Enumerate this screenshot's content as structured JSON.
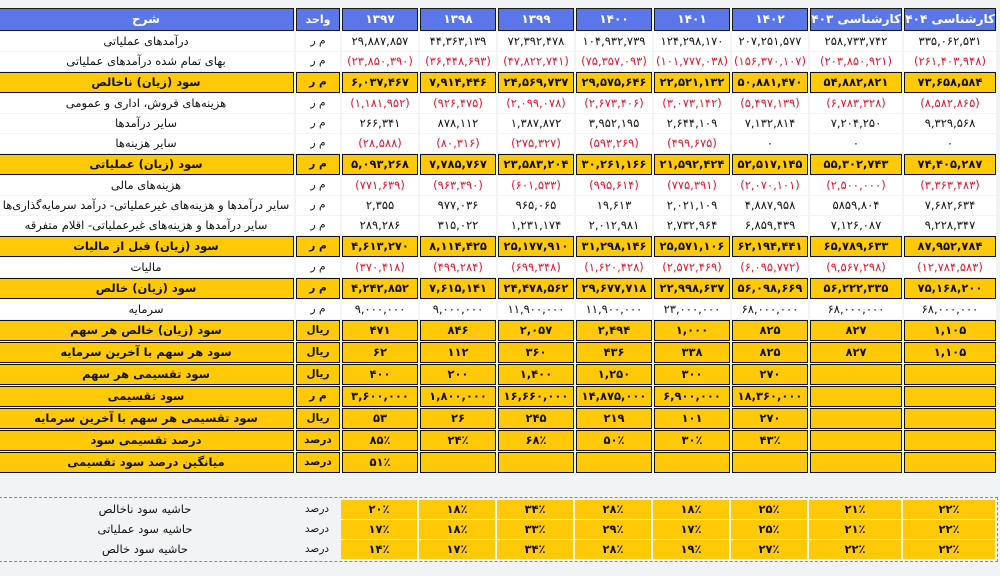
{
  "colors": {
    "header_bg": "#5a76e8",
    "header_fg": "#ffffff",
    "highlight_bg": "#ffc907",
    "negative_fg": "#e8132b",
    "page_bg": "#f2f3f5"
  },
  "header": {
    "description": "شرح",
    "unit": "واحد",
    "years": [
      "۱۳۹۷",
      "۱۳۹۸",
      "۱۳۹۹",
      "۱۴۰۰",
      "۱۴۰۱",
      "۱۴۰۲",
      "کارشناسی ۱۴۰۳",
      "کارشناسی ۱۴۰۴"
    ]
  },
  "rows": [
    {
      "label": "درآمدهای عملیاتی",
      "unit": "م ر",
      "style": "plain",
      "values": [
        "۲۹,۸۸۷,۸۵۷",
        "۴۴,۳۶۳,۱۳۹",
        "۷۲,۳۹۲,۴۷۸",
        "۱۰۴,۹۳۲,۷۳۹",
        "۱۲۴,۲۹۸,۱۷۰",
        "۲۰۷,۲۵۱,۵۷۷",
        "۲۵۸,۷۳۳,۷۴۲",
        "۳۳۵,۰۶۲,۵۳۱"
      ],
      "negative": [
        false,
        false,
        false,
        false,
        false,
        false,
        false,
        false
      ]
    },
    {
      "label": "بهای تمام شده درآمدهای عملیاتی",
      "unit": "م ر",
      "style": "plain",
      "values": [
        "(۲۳,۸۵۰,۳۹۰)",
        "(۳۶,۴۴۸,۶۹۳)",
        "(۴۷,۸۲۲,۷۴۱)",
        "(۷۵,۳۵۷,۰۹۳)",
        "(۱۰۱,۷۷۷,۰۳۸)",
        "(۱۵۶,۳۷۰,۱۰۷)",
        "(۲۰۳,۸۵۰,۹۲۱)",
        "(۲۶۱,۴۰۳,۹۴۸)"
      ],
      "negative": [
        true,
        true,
        true,
        true,
        true,
        true,
        true,
        true
      ]
    },
    {
      "label": "سود (زیان) ناخالص",
      "unit": "م ر",
      "style": "highlight",
      "values": [
        "۶,۰۳۷,۴۶۷",
        "۷,۹۱۴,۴۴۶",
        "۲۴,۵۶۹,۷۳۷",
        "۲۹,۵۷۵,۶۴۶",
        "۲۲,۵۲۱,۱۳۲",
        "۵۰,۸۸۱,۴۷۰",
        "۵۴,۸۸۲,۸۲۱",
        "۷۳,۶۵۸,۵۸۴"
      ],
      "negative": [
        false,
        false,
        false,
        false,
        false,
        false,
        false,
        false
      ]
    },
    {
      "label": "هزینه‌های فروش، اداری و عمومی",
      "unit": "م ر",
      "style": "plain",
      "values": [
        "(۱,۱۸۱,۹۵۲)",
        "(۹۲۶,۴۷۵)",
        "(۲,۰۹۹,۰۷۸)",
        "(۲,۶۷۳,۴۰۶)",
        "(۳,۰۷۳,۱۴۲)",
        "(۵,۴۹۷,۱۳۹)",
        "(۶,۷۸۳,۳۲۸)",
        "(۸,۵۸۲,۸۶۵)"
      ],
      "negative": [
        true,
        true,
        true,
        true,
        true,
        true,
        true,
        true
      ]
    },
    {
      "label": "سایر درآمدها",
      "unit": "م ر",
      "style": "plain",
      "values": [
        "۲۶۶,۳۴۱",
        "۸۷۸,۱۱۲",
        "۱,۳۸۷,۸۷۲",
        "۳,۹۵۲,۱۹۵",
        "۲,۶۴۴,۱۰۹",
        "۷,۱۳۲,۸۱۴",
        "۷,۲۰۴,۲۵۰",
        "۹,۳۲۹,۵۶۸"
      ],
      "negative": [
        false,
        false,
        false,
        false,
        false,
        false,
        false,
        false
      ]
    },
    {
      "label": "سایر هزینه‌ها",
      "unit": "م ر",
      "style": "plain",
      "values": [
        "(۲۸,۵۸۸)",
        "(۸۰,۳۱۶)",
        "(۲۷۵,۳۲۷)",
        "(۵۹۳,۲۶۹)",
        "(۴۹۹,۶۷۵)",
        "۰",
        "۰",
        "۰"
      ],
      "negative": [
        true,
        true,
        true,
        true,
        true,
        false,
        false,
        false
      ]
    },
    {
      "label": "سود (زیان) عملیاتی",
      "unit": "م ر",
      "style": "highlight",
      "values": [
        "۵,۰۹۳,۲۶۸",
        "۷,۷۸۵,۷۶۷",
        "۲۳,۵۸۳,۲۰۴",
        "۳۰,۲۶۱,۱۶۶",
        "۲۱,۵۹۲,۴۲۴",
        "۵۲,۵۱۷,۱۴۵",
        "۵۵,۳۰۲,۷۴۳",
        "۷۴,۴۰۵,۲۸۷"
      ],
      "negative": [
        false,
        false,
        false,
        false,
        false,
        false,
        false,
        false
      ]
    },
    {
      "label": "هزینه‌های مالی",
      "unit": "م ر",
      "style": "plain",
      "values": [
        "(۷۷۱,۶۳۹)",
        "(۹۶۳,۳۹۰)",
        "(۶۰۱,۵۳۳)",
        "(۹۹۵,۶۱۴)",
        "(۷۷۵,۳۹۱)",
        "(۲,۰۷۰,۱۰۱)",
        "(۲,۵۰۰,۰۰۰)",
        "(۳,۳۶۳,۴۸۳)"
      ],
      "negative": [
        true,
        true,
        true,
        true,
        true,
        true,
        true,
        true
      ]
    },
    {
      "label": "سایر درآمدها و هزینه‌های غیرعملیاتی- درآمد سرمایه‌گذاری‌ها",
      "unit": "م ر",
      "style": "plain",
      "values": [
        "۲,۳۵۵",
        "۹۷۷,۰۳۶",
        "۹۶۵,۰۶۵",
        "۱۹,۶۱۳",
        "۲,۰۲۱,۱۰۹",
        "۴,۸۸۷,۹۵۸",
        "۵۸۵۹,۸۰۴",
        "۷,۶۸۲,۶۳۴"
      ],
      "negative": [
        false,
        false,
        false,
        false,
        false,
        false,
        false,
        false
      ]
    },
    {
      "label": "سایر درآمدها و هزینه‌های غیرعملیاتی- اقلام متفرقه",
      "unit": "م ر",
      "style": "plain",
      "values": [
        "۲۸۹,۲۸۶",
        "۳۱۵,۰۲۲",
        "۱,۲۳۱,۱۷۴",
        "۲,۰۱۲,۹۸۱",
        "۲,۷۳۲,۹۶۴",
        "۶,۸۵۹,۴۳۹",
        "۷,۱۲۶,۰۸۷",
        "۹,۲۲۸,۳۴۷"
      ],
      "negative": [
        false,
        false,
        false,
        false,
        false,
        false,
        false,
        false
      ]
    },
    {
      "label": "سود (زیان) قبل از مالیات",
      "unit": "م ر",
      "style": "highlight",
      "values": [
        "۴,۶۱۳,۲۷۰",
        "۸,۱۱۴,۴۲۵",
        "۲۵,۱۷۷,۹۱۰",
        "۳۱,۲۹۸,۱۴۶",
        "۲۵,۵۷۱,۱۰۶",
        "۶۲,۱۹۴,۴۴۱",
        "۶۵,۷۸۹,۶۳۳",
        "۸۷,۹۵۲,۷۸۴"
      ],
      "negative": [
        false,
        false,
        false,
        false,
        false,
        false,
        false,
        false
      ]
    },
    {
      "label": "مالیات",
      "unit": "م ر",
      "style": "plain",
      "values": [
        "(۳۷۰,۴۱۸)",
        "(۴۹۹,۲۸۴)",
        "(۶۹۹,۳۴۸)",
        "(۱,۶۲۰,۴۲۸)",
        "(۲,۵۷۲,۴۶۹)",
        "(۶,۰۹۵,۷۷۲)",
        "(۹,۵۶۷,۲۹۸)",
        "(۱۲,۷۸۴,۵۸۳)"
      ],
      "negative": [
        true,
        true,
        true,
        true,
        true,
        true,
        true,
        true
      ]
    },
    {
      "label": "سود (زیان) خالص",
      "unit": "م ر",
      "style": "highlight",
      "values": [
        "۴,۲۴۲,۸۵۲",
        "۷,۶۱۵,۱۴۱",
        "۲۴,۴۷۸,۵۶۲",
        "۲۹,۶۷۷,۷۱۸",
        "۲۲,۹۹۸,۶۳۷",
        "۵۶,۰۹۸,۶۶۹",
        "۵۶,۲۲۲,۳۳۵",
        "۷۵,۱۶۸,۲۰۰"
      ],
      "negative": [
        false,
        false,
        false,
        false,
        false,
        false,
        false,
        false
      ]
    },
    {
      "label": "سرمایه",
      "unit": "م ر",
      "style": "plain",
      "values": [
        "۹,۰۰۰,۰۰۰",
        "۹,۰۰۰,۰۰۰",
        "۱۱,۹۰۰,۰۰۰",
        "۱۱,۹۰۰,۰۰۰",
        "۲۳,۰۰۰,۰۰۰",
        "۶۸,۰۰۰,۰۰۰",
        "۶۸,۰۰۰,۰۰۰",
        "۶۸,۰۰۰,۰۰۰"
      ],
      "negative": [
        false,
        false,
        false,
        false,
        false,
        false,
        false,
        false
      ]
    },
    {
      "label": "سود (زیان) خالص هر سهم",
      "unit": "ریال",
      "style": "highlight",
      "values": [
        "۴۷۱",
        "۸۴۶",
        "۲,۰۵۷",
        "۲,۴۹۴",
        "۱,۰۰۰",
        "۸۲۵",
        "۸۲۷",
        "۱,۱۰۵"
      ],
      "negative": [
        false,
        false,
        false,
        false,
        false,
        false,
        false,
        false
      ]
    },
    {
      "label": "سود هر سهم با آخرین سرمایه",
      "unit": "ریال",
      "style": "highlight",
      "values": [
        "۶۲",
        "۱۱۲",
        "۳۶۰",
        "۴۳۶",
        "۳۳۸",
        "۸۲۵",
        "۸۲۷",
        "۱,۱۰۵"
      ],
      "negative": [
        false,
        false,
        false,
        false,
        false,
        false,
        false,
        false
      ]
    },
    {
      "label": "سود تقسیمی هر سهم",
      "unit": "ریال",
      "style": "highlight",
      "values": [
        "۴۰۰",
        "۲۰۰",
        "۱,۴۰۰",
        "۱,۲۵۰",
        "۳۰۰",
        "۲۷۰",
        "",
        ""
      ],
      "negative": [
        false,
        false,
        false,
        false,
        false,
        false,
        false,
        false
      ]
    },
    {
      "label": "سود تقسیمی",
      "unit": "م ر",
      "style": "highlight",
      "values": [
        "۳,۶۰۰,۰۰۰",
        "۱,۸۰۰,۰۰۰",
        "۱۶,۶۶۰,۰۰۰",
        "۱۴,۸۷۵,۰۰۰",
        "۶,۹۰۰,۰۰۰",
        "۱۸,۳۶۰,۰۰۰",
        "",
        ""
      ],
      "negative": [
        false,
        false,
        false,
        false,
        false,
        false,
        false,
        false
      ]
    },
    {
      "label": "سود تقسیمی هر سهم با آخرین سرمایه",
      "unit": "ریال",
      "style": "highlight",
      "values": [
        "۵۳",
        "۲۶",
        "۲۴۵",
        "۲۱۹",
        "۱۰۱",
        "۲۷۰",
        "",
        ""
      ],
      "negative": [
        false,
        false,
        false,
        false,
        false,
        false,
        false,
        false
      ]
    },
    {
      "label": "درصد تقسیمی سود",
      "unit": "درصد",
      "style": "highlight",
      "values": [
        "۸۵٪",
        "۲۴٪",
        "۶۸٪",
        "۵۰٪",
        "۳۰٪",
        "۴۳٪",
        "",
        ""
      ],
      "negative": [
        false,
        false,
        false,
        false,
        false,
        false,
        false,
        false
      ]
    },
    {
      "label": "میانگین درصد سود تقسیمی",
      "unit": "درصد",
      "style": "highlight",
      "values": [
        "۵۱٪",
        "",
        "",
        "",
        "",
        "",
        "",
        ""
      ],
      "negative": [
        false,
        false,
        false,
        false,
        false,
        false,
        false,
        false
      ]
    }
  ],
  "margin_rows": [
    {
      "label": "حاشیه سود ناخالص",
      "unit": "درصد",
      "values": [
        "۲۰٪",
        "۱۸٪",
        "۳۴٪",
        "۲۸٪",
        "۱۸٪",
        "۲۵٪",
        "۲۱٪",
        "۲۲٪"
      ]
    },
    {
      "label": "حاشیه سود عملیاتی",
      "unit": "درصد",
      "values": [
        "۱۷٪",
        "۱۸٪",
        "۳۳٪",
        "۲۹٪",
        "۱۷٪",
        "۲۵٪",
        "۲۱٪",
        "۲۲٪"
      ]
    },
    {
      "label": "حاشیه سود خالص",
      "unit": "درصد",
      "values": [
        "۱۴٪",
        "۱۷٪",
        "۳۴٪",
        "۲۸٪",
        "۱۹٪",
        "۲۷٪",
        "۲۲٪",
        "۲۲٪"
      ]
    }
  ]
}
